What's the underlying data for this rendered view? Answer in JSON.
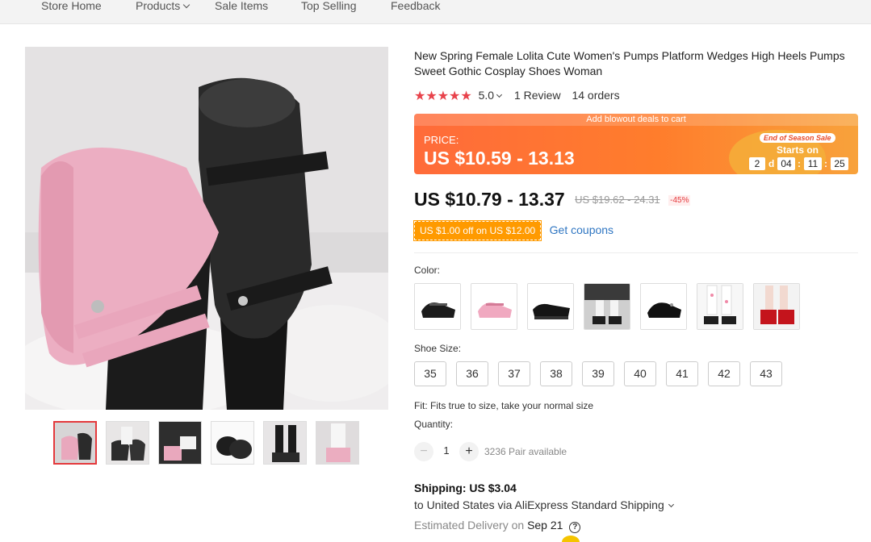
{
  "nav": {
    "items": [
      {
        "label": "Store Home"
      },
      {
        "label": "Products",
        "has_dropdown": true
      },
      {
        "label": "Sale Items"
      },
      {
        "label": "Top Selling"
      },
      {
        "label": "Feedback"
      }
    ]
  },
  "gallery": {
    "thumbnails": [
      {
        "icon": "shoe-thumbnail",
        "active": true
      },
      {
        "icon": "shoe-thumbnail"
      },
      {
        "icon": "shoe-thumbnail"
      },
      {
        "icon": "shoe-thumbnail"
      },
      {
        "icon": "shoe-thumbnail"
      },
      {
        "icon": "shoe-thumbnail"
      }
    ]
  },
  "product": {
    "title": "New Spring Female Lolita Cute Women's Pumps Platform Wedges High Heels Pumps Sweet Gothic Cosplay Shoes Woman",
    "stars": "★★★★★",
    "rating": "5.0",
    "reviews": "1 Review",
    "orders": "14 orders"
  },
  "promo": {
    "banner": "Add blowout deals to cart",
    "price_label": "PRICE:",
    "price": "US $10.59 - 13.13",
    "badge": "End of Season Sale",
    "starts_on": "Starts on",
    "countdown": {
      "days": "2",
      "days_unit": "d",
      "hours": "04",
      "minutes": "11",
      "seconds": "25",
      "separator": ":"
    }
  },
  "price": {
    "current": "US $10.79 - 13.37",
    "original": "US $19.62 - 24.31",
    "discount": "-45%"
  },
  "coupon": {
    "badge": "US $1.00 off on US $12.00",
    "link": "Get coupons"
  },
  "color": {
    "label": "Color:",
    "options": [
      {
        "icon": "black-shoe-swatch"
      },
      {
        "icon": "pink-shoe-swatch"
      },
      {
        "icon": "black-shoe-swatch"
      },
      {
        "icon": "worn-black-shoe-swatch"
      },
      {
        "icon": "black-shoe-swatch"
      },
      {
        "icon": "white-sock-shoe-swatch"
      },
      {
        "icon": "red-shoe-swatch"
      }
    ]
  },
  "size": {
    "label": "Shoe Size:",
    "options": [
      "35",
      "36",
      "37",
      "38",
      "39",
      "40",
      "41",
      "42",
      "43"
    ]
  },
  "fit": "Fit: Fits true to size, take your normal size",
  "quantity": {
    "label": "Quantity:",
    "minus": "−",
    "plus": "+",
    "value": "1",
    "available": "3236 Pair available"
  },
  "shipping": {
    "title": "Shipping: US $3.04",
    "to": "to United States via AliExpress Standard Shipping",
    "est_label": "Estimated Delivery on",
    "est_date": "Sep 21",
    "help": "?"
  },
  "colors": {
    "accent": "#e4393c",
    "promo": "#ff7a30",
    "link": "#2f76c2",
    "coupon": "#ff9a00"
  }
}
